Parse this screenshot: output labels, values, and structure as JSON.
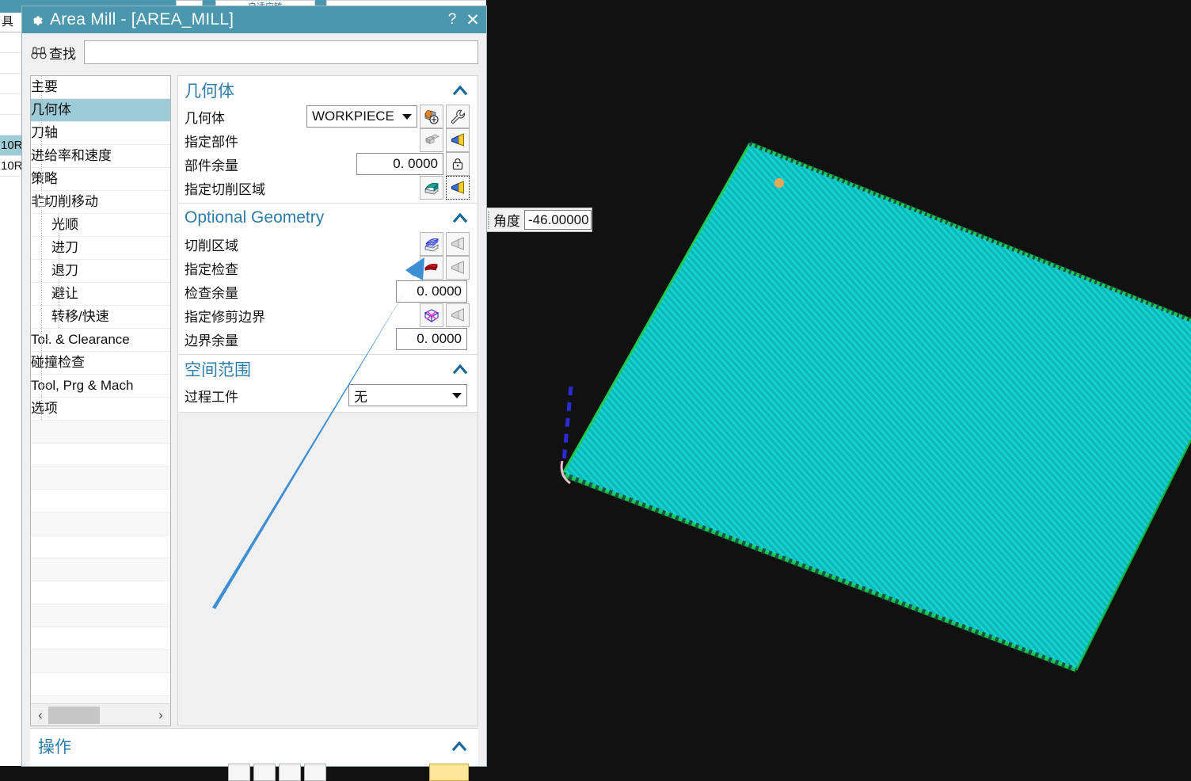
{
  "background": {
    "left_panel_header": "具",
    "left_panel_rows": [
      "",
      "",
      "",
      "",
      "",
      "10R",
      "10R"
    ],
    "tab_label": "自适应铣"
  },
  "viewport": {
    "angle_label": "角度",
    "angle_value": "-46.00000",
    "colors": {
      "background": "#111111",
      "surface": "#11c4c4",
      "toolpath": "#0ec9c4",
      "edge_green": "#19c24a",
      "rapid_blue": "#2b2bd6",
      "marker_orange": "#f3a65a",
      "engage_pink": "#e8b8c8"
    }
  },
  "dialog": {
    "title": "Area Mill - [AREA_MILL]",
    "title_icon": "gear-icon",
    "help_label": "?",
    "close_label": "✕",
    "find": {
      "label": "查找",
      "icon": "binoculars-icon",
      "value": "",
      "placeholder": ""
    },
    "tree": [
      {
        "label": "主要",
        "level": 0,
        "selected": false,
        "expander": false
      },
      {
        "label": "几何体",
        "level": 0,
        "selected": true,
        "expander": false
      },
      {
        "label": "刀轴",
        "level": 0,
        "selected": false,
        "expander": false
      },
      {
        "label": "进给率和速度",
        "level": 0,
        "selected": false,
        "expander": false
      },
      {
        "label": "策略",
        "level": 0,
        "selected": false,
        "expander": false
      },
      {
        "label": "非切削移动",
        "level": 0,
        "selected": false,
        "expander": true
      },
      {
        "label": "光顺",
        "level": 1,
        "selected": false,
        "expander": false
      },
      {
        "label": "进刀",
        "level": 1,
        "selected": false,
        "expander": false
      },
      {
        "label": "退刀",
        "level": 1,
        "selected": false,
        "expander": false
      },
      {
        "label": "避让",
        "level": 1,
        "selected": false,
        "expander": false
      },
      {
        "label": "转移/快速",
        "level": 1,
        "selected": false,
        "expander": false
      },
      {
        "label": "Tol. & Clearance",
        "level": 0,
        "selected": false,
        "expander": false
      },
      {
        "label": "碰撞检查",
        "level": 0,
        "selected": false,
        "expander": false
      },
      {
        "label": "Tool, Prg & Mach",
        "level": 0,
        "selected": false,
        "expander": false
      },
      {
        "label": "选项",
        "level": 0,
        "selected": false,
        "expander": false
      }
    ],
    "sections": {
      "geometry": {
        "title": "几何体",
        "collapse_icon": "chevron-up-icon",
        "geometry_row": {
          "label": "几何体",
          "value": "WORKPIECE",
          "edit_icon": "geometry-add-icon",
          "tool_icon": "wrench-icon"
        },
        "part_row": {
          "label": "指定部件",
          "select_icon": "part-blocks-icon",
          "display_icon": "flashlight-icon"
        },
        "part_stock_row": {
          "label": "部件余量",
          "value": "0. 0000",
          "lock_icon": "lock-icon"
        },
        "cut_area_row": {
          "label": "指定切削区域",
          "select_icon": "cut-area-surface-icon",
          "display_icon": "flashlight-icon"
        }
      },
      "optional_geometry": {
        "title": "Optional Geometry",
        "collapse_icon": "chevron-up-icon",
        "cut_area_row": {
          "label": "切削区域",
          "select_icon": "surface-stack-icon",
          "display_icon": "flashlight-disabled-icon"
        },
        "check_row": {
          "label": "指定检查",
          "select_icon": "check-body-red-icon",
          "display_icon": "flashlight-disabled-icon"
        },
        "check_stock_row": {
          "label": "检查余量",
          "value": "0. 0000"
        },
        "trim_row": {
          "label": "指定修剪边界",
          "select_icon": "trim-boundary-icon",
          "display_icon": "flashlight-disabled-icon"
        },
        "trim_stock_row": {
          "label": "边界余量",
          "value": "0. 0000"
        }
      },
      "spatial_range": {
        "title": "空间范围",
        "collapse_icon": "chevron-up-icon",
        "ipw_row": {
          "label": "过程工件",
          "value": "无"
        }
      },
      "operation": {
        "title": "操作",
        "collapse_icon": "chevron-up-icon"
      }
    },
    "tree_scrollbar": {
      "left_arrow": "‹",
      "right_arrow": "›"
    }
  },
  "annotation": {
    "arrow_color": "#3d8fd4",
    "points_at": "optional-geometry-cut-area-select-icon"
  },
  "theme": {
    "titlebar": "#4b97ae",
    "section_heading": "#2e7ca8",
    "selection": "#9ecbd8",
    "panel_bg": "#f0f0f0"
  }
}
